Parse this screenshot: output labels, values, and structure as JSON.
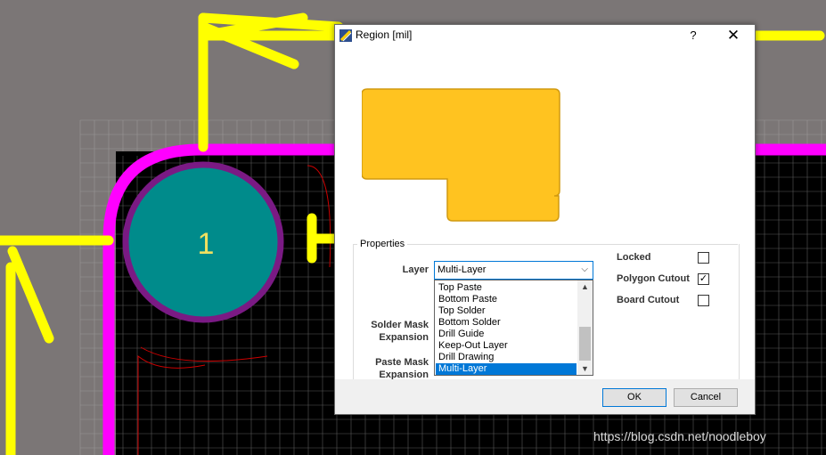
{
  "dialog": {
    "title": "Region [mil]",
    "help_glyph": "?",
    "close_glyph": "✕"
  },
  "pad": {
    "number": "1"
  },
  "properties": {
    "group_label": "Properties",
    "layer_label": "Layer",
    "layer_value": "Multi-Layer",
    "solder_mask_label_1": "Solder Mask",
    "solder_mask_label_2": "Expansion",
    "paste_mask_label_1": "Paste Mask",
    "paste_mask_label_2": "Expansion",
    "layer_options": [
      "Top Paste",
      "Bottom Paste",
      "Top Solder",
      "Bottom Solder",
      "Drill Guide",
      "Keep-Out Layer",
      "Drill Drawing",
      "Multi-Layer"
    ],
    "selected_option": "Multi-Layer",
    "checkboxes": [
      {
        "label": "Locked",
        "checked": false
      },
      {
        "label": "Polygon Cutout",
        "checked": true
      },
      {
        "label": "Board Cutout",
        "checked": false
      }
    ]
  },
  "buttons": {
    "ok": "OK",
    "cancel": "Cancel"
  },
  "watermark": "https://blog.csdn.net/noodleboy",
  "colors": {
    "canvas_bg": "#7b7676",
    "board": "#000000",
    "grid": "#9a9696",
    "magenta_outline": "#ff00ff",
    "yellow_arrows": "#ffff00",
    "pad_fill": "#008b8b",
    "pad_ring": "#7a1a84",
    "region_fill": "#ffc320",
    "selection_blue": "#0078d7"
  },
  "icons": {
    "title_icon": "pcb-region-icon"
  }
}
